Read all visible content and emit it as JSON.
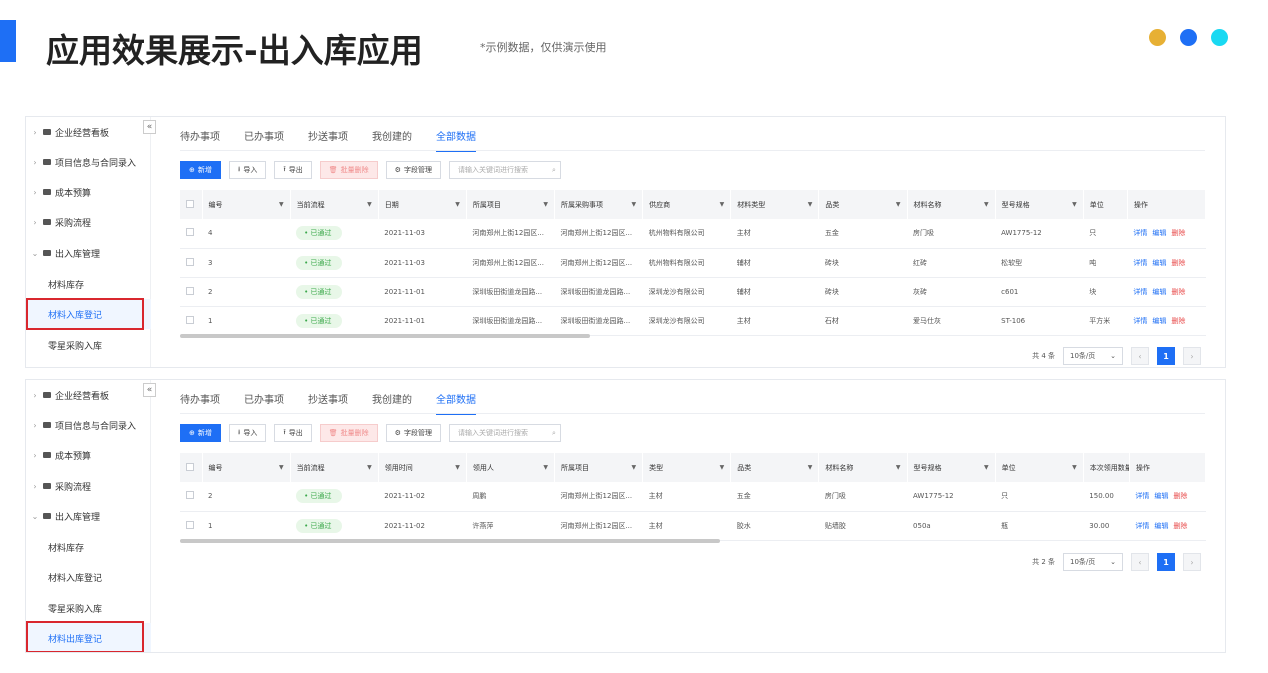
{
  "header": {
    "title": "应用效果展示-出入库应用",
    "subtitle": "*示例数据，仅供演示使用",
    "dot_colors": [
      "#e7b034",
      "#1e6ff5",
      "#19d9f2"
    ],
    "accent": "#1e6ff5"
  },
  "panel1": {
    "sidebar": {
      "collapse": "«",
      "items": [
        {
          "label": "企业经营看板",
          "chev": "›"
        },
        {
          "label": "项目信息与合同录入",
          "chev": "›"
        },
        {
          "label": "成本预算",
          "chev": "›"
        },
        {
          "label": "采购流程",
          "chev": "›"
        },
        {
          "label": "出入库管理",
          "chev": "⌄"
        },
        {
          "label": "材料库存"
        },
        {
          "label": "材料入库登记"
        },
        {
          "label": "零星采购入库"
        }
      ]
    },
    "tabs": [
      "待办事项",
      "已办事项",
      "抄送事项",
      "我创建的",
      "全部数据"
    ],
    "toolbar": {
      "add": "新增",
      "import": "导入",
      "export": "导出",
      "batch_delete": "批量删除",
      "fields": "字段管理",
      "search_placeholder": "请输入关键词进行搜索"
    },
    "columns": [
      "编号",
      "当前流程",
      "日期",
      "所属项目",
      "所属采购事项",
      "供应商",
      "材料类型",
      "品类",
      "材料名称",
      "型号规格",
      "单位",
      "操作"
    ],
    "rows": [
      [
        "4",
        "已通过",
        "2021-11-03",
        "河南郑州上街12园区...",
        "河南郑州上街12园区...",
        "杭州物料有限公司",
        "主材",
        "五金",
        "房门吸",
        "AW1775-12",
        "只"
      ],
      [
        "3",
        "已通过",
        "2021-11-03",
        "河南郑州上街12园区...",
        "河南郑州上街12园区...",
        "杭州物料有限公司",
        "辅材",
        "砖块",
        "红砖",
        "松软型",
        "吨"
      ],
      [
        "2",
        "已通过",
        "2021-11-01",
        "深圳坂田街道龙园路...",
        "深圳坂田街道龙园路...",
        "深圳龙沙有限公司",
        "辅材",
        "砖块",
        "灰砖",
        "c601",
        "块"
      ],
      [
        "1",
        "已通过",
        "2021-11-01",
        "深圳坂田街道龙园路...",
        "深圳坂田街道龙园路...",
        "深圳龙沙有限公司",
        "主材",
        "石材",
        "爱马仕灰",
        "ST-106",
        "平方米"
      ]
    ],
    "actions": {
      "detail": "详情",
      "edit": "编辑",
      "delete": "删除"
    },
    "pager": {
      "total": "共 4 条",
      "page_size": "10条/页",
      "page": "1"
    }
  },
  "panel2": {
    "sidebar": {
      "collapse": "«",
      "items": [
        {
          "label": "企业经营看板",
          "chev": "›"
        },
        {
          "label": "项目信息与合同录入",
          "chev": "›"
        },
        {
          "label": "成本预算",
          "chev": "›"
        },
        {
          "label": "采购流程",
          "chev": "›"
        },
        {
          "label": "出入库管理",
          "chev": "⌄"
        },
        {
          "label": "材料库存"
        },
        {
          "label": "材料入库登记"
        },
        {
          "label": "零星采购入库"
        },
        {
          "label": "材料出库登记"
        }
      ]
    },
    "tabs": [
      "待办事项",
      "已办事项",
      "抄送事项",
      "我创建的",
      "全部数据"
    ],
    "toolbar": {
      "add": "新增",
      "import": "导入",
      "export": "导出",
      "batch_delete": "批量删除",
      "fields": "字段管理",
      "search_placeholder": "请输入关键词进行搜索"
    },
    "columns": [
      "编号",
      "当前流程",
      "领用时间",
      "领用人",
      "所属项目",
      "类型",
      "品类",
      "材料名称",
      "型号规格",
      "单位",
      "本次领用数量",
      "操作"
    ],
    "rows": [
      [
        "2",
        "已通过",
        "2021-11-02",
        "周鹏",
        "河南郑州上街12园区...",
        "主材",
        "五金",
        "房门吸",
        "AW1775-12",
        "只",
        "150.00"
      ],
      [
        "1",
        "已通过",
        "2021-11-02",
        "许燕萍",
        "河南郑州上街12园区...",
        "主材",
        "胶水",
        "贴墙胶",
        "050a",
        "瓶",
        "30.00"
      ]
    ],
    "actions": {
      "detail": "详情",
      "edit": "编辑",
      "delete": "删除"
    },
    "pager": {
      "total": "共 2 条",
      "page_size": "10条/页",
      "page": "1"
    }
  }
}
